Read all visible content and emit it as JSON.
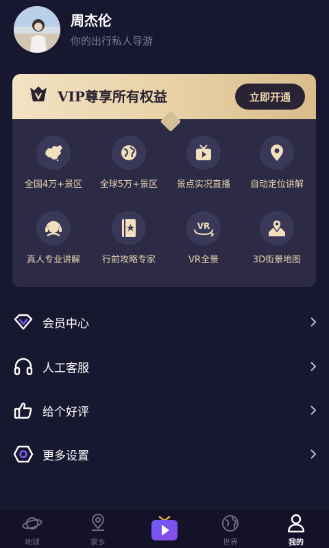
{
  "profile": {
    "name": "周杰伦",
    "subtitle": "你的出行私人导游"
  },
  "vip": {
    "title": "VIP尊享所有权益",
    "button": "立即开通",
    "features": [
      {
        "label": "全国4万+景区",
        "icon": "china-map-icon"
      },
      {
        "label": "全球5万+景区",
        "icon": "globe-icon"
      },
      {
        "label": "景点实况直播",
        "icon": "tv-icon"
      },
      {
        "label": "自动定位讲解",
        "icon": "location-pin-icon"
      },
      {
        "label": "真人专业讲解",
        "icon": "headset-guide-icon"
      },
      {
        "label": "行前攻略专家",
        "icon": "guidebook-icon"
      },
      {
        "label": "VR全景",
        "icon": "vr-icon"
      },
      {
        "label": "3D街景地图",
        "icon": "map-pin-icon"
      }
    ]
  },
  "menu": [
    {
      "label": "会员中心",
      "icon": "vip-diamond-icon"
    },
    {
      "label": "人工客服",
      "icon": "headphones-icon"
    },
    {
      "label": "给个好评",
      "icon": "thumbs-up-icon"
    },
    {
      "label": "更多设置",
      "icon": "settings-hexagon-icon"
    }
  ],
  "tabs": [
    {
      "label": "地球",
      "icon": "planet-icon",
      "active": false
    },
    {
      "label": "家乡",
      "icon": "location-icon",
      "active": false
    },
    {
      "label": "",
      "icon": "play-tv-icon",
      "active": false
    },
    {
      "label": "世界",
      "icon": "world-icon",
      "active": false
    },
    {
      "label": "我的",
      "icon": "person-icon",
      "active": true
    }
  ],
  "colors": {
    "background": "#181730",
    "card": "#2c2a45",
    "gold": "#e6d4b0",
    "accent_purple": "#7a5cf0"
  }
}
